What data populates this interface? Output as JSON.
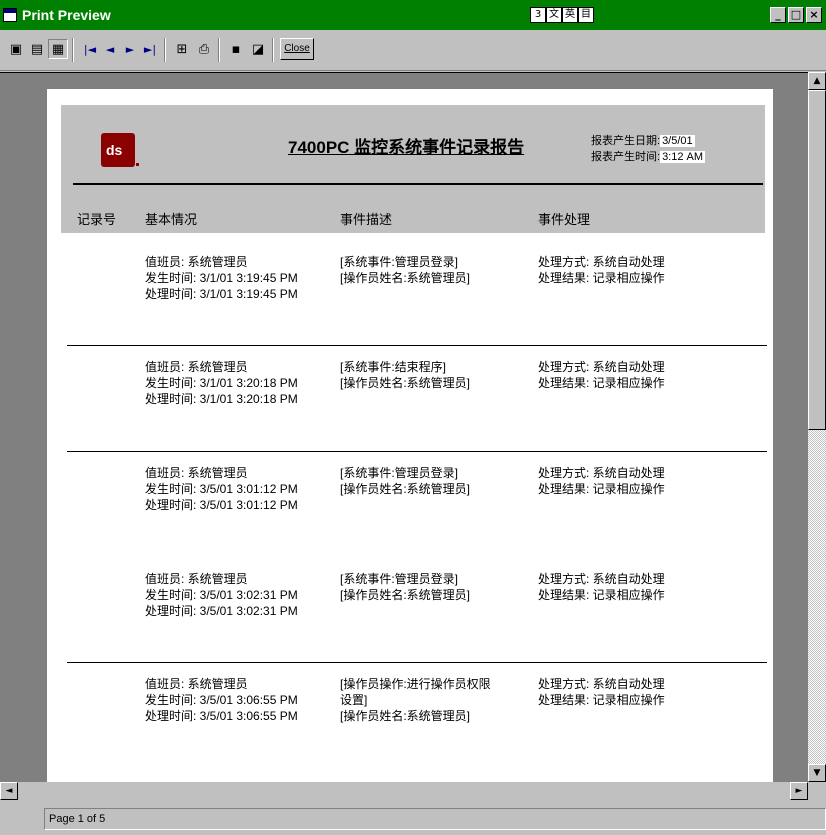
{
  "window": {
    "title": "Print Preview",
    "ime_glyphs": [
      "3",
      "文",
      "英",
      "目"
    ],
    "controls": [
      "_",
      "□",
      "×"
    ]
  },
  "toolbar": {
    "buttons": [
      "one-page-icon",
      "two-page-icon",
      "multi-page-icon",
      "first-page-icon",
      "prev-page-icon",
      "next-page-icon",
      "last-page-icon",
      "zoom-icon",
      "print-icon",
      "save-icon",
      "open-icon"
    ],
    "close_label": "Close"
  },
  "report": {
    "logo_text": "ds",
    "title": "7400PC 监控系统事件记录报告",
    "meta": {
      "date_label": "报表产生日期:",
      "date_value": "3/5/01",
      "time_label": "报表产生时间:",
      "time_value": "3:12 AM"
    },
    "columns": [
      "记录号",
      "基本情况",
      "事件描述",
      "事件处理"
    ],
    "records": [
      {
        "basic": [
          "值班员:    系统管理员",
          "发生时间:  3/1/01 3:19:45 PM",
          "处理时间:  3/1/01 3:19:45 PM"
        ],
        "desc": [
          "[系统事件:管理员登录]",
          "[操作员姓名:系统管理员]"
        ],
        "handle": [
          "处理方式:   系统自动处理",
          "处理结果:   记录相应操作"
        ]
      },
      {
        "basic": [
          "值班员:    系统管理员",
          "发生时间:  3/1/01 3:20:18 PM",
          "处理时间:  3/1/01 3:20:18 PM"
        ],
        "desc": [
          "[系统事件:结束程序]",
          "[操作员姓名:系统管理员]"
        ],
        "handle": [
          "处理方式:   系统自动处理",
          "处理结果:   记录相应操作"
        ]
      },
      {
        "basic": [
          "值班员:    系统管理员",
          "发生时间:  3/5/01 3:01:12 PM",
          "处理时间:  3/5/01 3:01:12 PM"
        ],
        "desc": [
          "[系统事件:管理员登录]",
          "[操作员姓名:系统管理员]"
        ],
        "handle": [
          "处理方式:   系统自动处理",
          "处理结果:   记录相应操作"
        ]
      },
      {
        "basic": [
          "值班员:    系统管理员",
          "发生时间:  3/5/01 3:02:31 PM",
          "处理时间:  3/5/01 3:02:31 PM"
        ],
        "desc": [
          "[系统事件:管理员登录]",
          "[操作员姓名:系统管理员]"
        ],
        "handle": [
          "处理方式:   系统自动处理",
          "处理结果:   记录相应操作"
        ]
      },
      {
        "basic": [
          "值班员:    系统管理员",
          "发生时间:  3/5/01 3:06:55 PM",
          "处理时间:  3/5/01 3:06:55 PM"
        ],
        "desc": [
          "[操作员操作:进行操作员权限",
          "设置]",
          "[操作员姓名:系统管理员]"
        ],
        "handle": [
          "处理方式:   系统自动处理",
          "处理结果:   记录相应操作"
        ]
      }
    ]
  },
  "scroll": {
    "up": "▲",
    "down": "▼",
    "left": "◄",
    "right": "►"
  },
  "status": {
    "page_text": "Page 1 of 5"
  },
  "colors": {
    "titlebar": "#008000",
    "logo": "#8b0000",
    "chrome": "#c0c0c0"
  }
}
